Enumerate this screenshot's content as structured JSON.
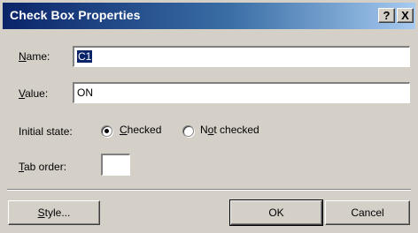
{
  "window": {
    "title": "Check Box Properties",
    "help_label": "?",
    "close_label": "X"
  },
  "form": {
    "name_label_key": "N",
    "name_label_rest": "ame:",
    "name_value": "C1",
    "value_label_key": "V",
    "value_label_rest": "alue:",
    "value_value": "ON",
    "initial_state_label": "Initial state:",
    "checked_key": "C",
    "checked_rest": "hecked",
    "notchecked_pre": "N",
    "notchecked_key": "o",
    "notchecked_rest": "t checked",
    "selected_state": "Checked",
    "taborder_key": "T",
    "taborder_rest": "ab order:",
    "taborder_value": ""
  },
  "buttons": {
    "style_key": "S",
    "style_rest": "tyle...",
    "ok_label": "OK",
    "cancel_label": "Cancel"
  }
}
